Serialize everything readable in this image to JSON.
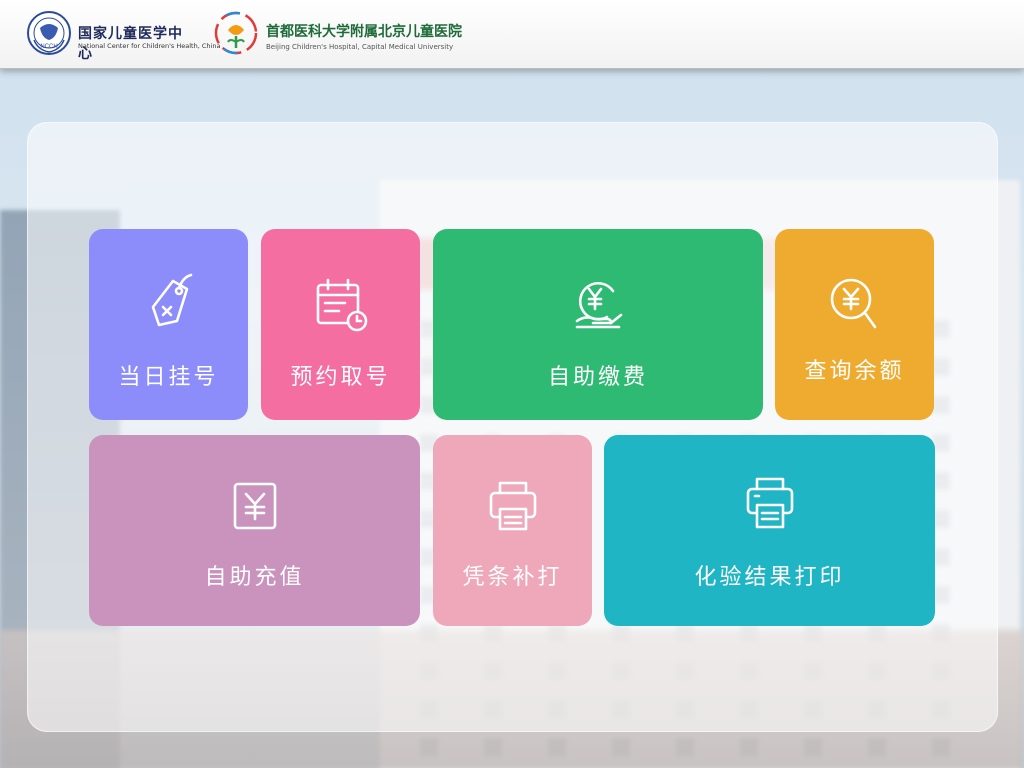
{
  "header": {
    "logo_ncch": {
      "name": "国家儿童医学中心",
      "subtitle": "National Center for Children's Health, China",
      "emblem_text": "NCCH"
    },
    "logo_bch": {
      "name": "首都医科大学附属北京儿童医院",
      "subtitle": "Beijing Children's Hospital, Capital Medical University"
    }
  },
  "tiles": [
    {
      "id": "same-day",
      "label": "当日挂号",
      "color": "#8c8dfb",
      "icon": "tag-icon"
    },
    {
      "id": "appointment",
      "label": "预约取号",
      "color": "#f56ea2",
      "icon": "calendar-clock-icon"
    },
    {
      "id": "self-pay",
      "label": "自助缴费",
      "color": "#2fba73",
      "icon": "yen-hand-icon"
    },
    {
      "id": "balance",
      "label": "查询余额",
      "color": "#efab30",
      "icon": "yen-search-icon"
    },
    {
      "id": "top-up",
      "label": "自助充值",
      "color": "#c993be",
      "icon": "yen-card-icon"
    },
    {
      "id": "reprint",
      "label": "凭条补打",
      "color": "#eea8ba",
      "icon": "printer-icon"
    },
    {
      "id": "lab-print",
      "label": "化验结果打印",
      "color": "#1fb5c4",
      "icon": "printer-document-icon"
    }
  ]
}
